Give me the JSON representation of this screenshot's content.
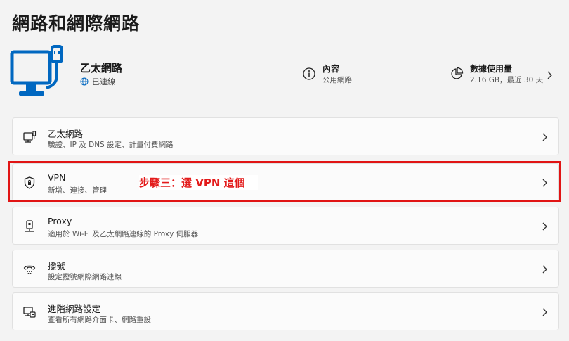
{
  "page": {
    "title": "網路和網際網路"
  },
  "connection": {
    "name": "乙太網路",
    "status": "已連線",
    "properties": {
      "title": "內容",
      "subtitle": "公用網路"
    },
    "usage": {
      "title": "數據使用量",
      "subtitle": "2.16 GB，最近 30 天"
    }
  },
  "settings": [
    {
      "title": "乙太網路",
      "subtitle": "驗證、IP 及 DNS 設定、計量付費網路",
      "icon": "ethernet-icon"
    },
    {
      "title": "VPN",
      "subtitle": "新增、連接、管理",
      "icon": "shield-icon"
    },
    {
      "title": "Proxy",
      "subtitle": "適用於 Wi-Fi 及乙太網路連線的 Proxy 伺服器",
      "icon": "proxy-icon"
    },
    {
      "title": "撥號",
      "subtitle": "設定撥號網際網路連線",
      "icon": "dialup-icon"
    },
    {
      "title": "進階網路設定",
      "subtitle": "查看所有網路介面卡、網路重設",
      "icon": "advanced-network-icon"
    }
  ],
  "annotation": {
    "text": "步驟三：選 VPN 這個"
  },
  "colors": {
    "accent": "#0067c0",
    "highlight": "#e11414"
  }
}
